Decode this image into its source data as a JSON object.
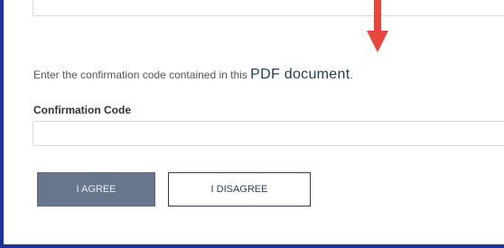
{
  "form": {
    "instruction_prefix": "Enter the confirmation code contained in this ",
    "pdf_link": "PDF document",
    "instruction_suffix": ".",
    "code_label": "Confirmation Code",
    "code_value": "",
    "code_placeholder": ""
  },
  "buttons": {
    "agree_label": "I AGREE",
    "disagree_label": "I DISAGREE"
  },
  "annotation": {
    "arrow_icon": "down-arrow-icon",
    "arrow_color": "#e8453c"
  },
  "colors": {
    "frame_border": "#1f2f9e",
    "agree_bg": "#66768d",
    "link_color": "#1b3a5c"
  }
}
